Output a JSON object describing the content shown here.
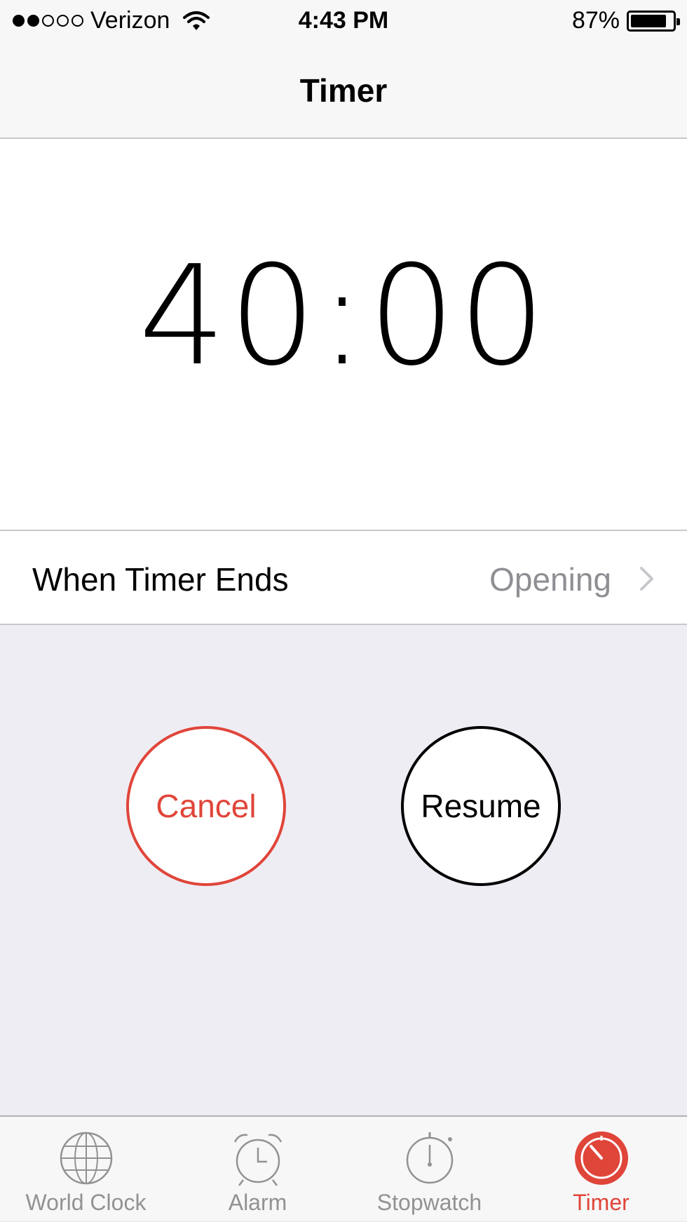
{
  "status_bar": {
    "carrier": "Verizon",
    "signal_bars_filled": 2,
    "signal_bars_total": 5,
    "time": "4:43 PM",
    "battery_percent": "87%",
    "battery_level": 0.87
  },
  "nav": {
    "title": "Timer"
  },
  "timer": {
    "display": "40:00"
  },
  "settings_row": {
    "label": "When Timer Ends",
    "value": "Opening"
  },
  "buttons": {
    "cancel": "Cancel",
    "resume": "Resume"
  },
  "tabs": [
    {
      "label": "World Clock",
      "icon": "globe-icon",
      "active": false
    },
    {
      "label": "Alarm",
      "icon": "alarm-clock-icon",
      "active": false
    },
    {
      "label": "Stopwatch",
      "icon": "stopwatch-icon",
      "active": false
    },
    {
      "label": "Timer",
      "icon": "timer-icon",
      "active": true
    }
  ],
  "colors": {
    "accent": "#e0453a",
    "secondary_text": "#8e8e93",
    "background": "#efedf4"
  }
}
